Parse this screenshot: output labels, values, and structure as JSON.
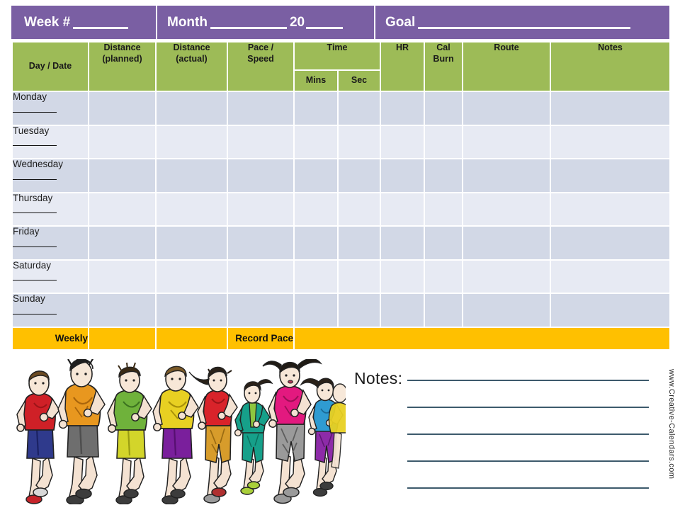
{
  "header": {
    "week_label": "Week #",
    "month_label": "Month",
    "year_prefix": "20",
    "goal_label": "Goal"
  },
  "table": {
    "columns": [
      "Day / Date",
      "Distance (planned)",
      "Distance (actual)",
      "Pace / Speed",
      "Time",
      "HR",
      "Cal Burn",
      "Route",
      "Notes"
    ],
    "col_day": "Day / Date",
    "col_dist_planned_l1": "Distance",
    "col_dist_planned_l2": "(planned)",
    "col_dist_actual_l1": "Distance",
    "col_dist_actual_l2": "(actual)",
    "col_pace_l1": "Pace /",
    "col_pace_l2": "Speed",
    "col_time": "Time",
    "col_mins": "Mins",
    "col_sec": "Sec",
    "col_hr": "HR",
    "col_cal_l1": "Cal",
    "col_cal_l2": "Burn",
    "col_route": "Route",
    "col_notes": "Notes",
    "rows": [
      {
        "day": "Monday"
      },
      {
        "day": "Tuesday"
      },
      {
        "day": "Wednesday"
      },
      {
        "day": "Thursday"
      },
      {
        "day": "Friday"
      },
      {
        "day": "Saturday"
      },
      {
        "day": "Sunday"
      }
    ],
    "summary": {
      "weekly": "Weekly",
      "record_pace": "Record Pace"
    }
  },
  "notes": {
    "label": "Notes:",
    "line_count": 5
  },
  "watermark": "www.Creative-Calendars.com",
  "colors": {
    "purple": "#7a5fa3",
    "green": "#9dbb57",
    "row_dark": "#d2d8e6",
    "row_light": "#e7eaf3",
    "yellow": "#FFC000",
    "note_line": "#3d5a6c"
  },
  "illustration": {
    "name": "group-of-runners",
    "runner_count": 9,
    "shirt_colors": [
      "#cf2027",
      "#e8971f",
      "#6fb23b",
      "#e8d022",
      "#d9232a",
      "#16a08a",
      "#e3197f",
      "#2f9bd1"
    ],
    "short_colors": [
      "#3b3b8f",
      "#6e6e6e",
      "#d3d52a",
      "#7a1f9c",
      "#d79c2b",
      "#16a08a",
      "#9a9a9a",
      "#8d2ba8"
    ]
  }
}
